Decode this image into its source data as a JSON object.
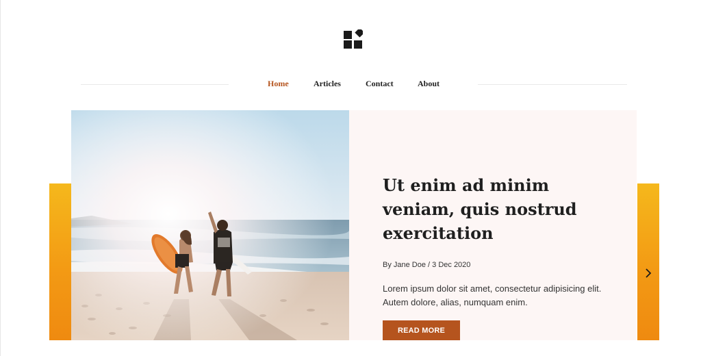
{
  "nav": {
    "items": [
      {
        "label": "Home",
        "active": true
      },
      {
        "label": "Articles",
        "active": false
      },
      {
        "label": "Contact",
        "active": false
      },
      {
        "label": "About",
        "active": false
      }
    ]
  },
  "logo": {
    "icon": "blocks-logo-icon"
  },
  "slide": {
    "title": "Ut enim ad minim veniam, quis nostrud exercitation",
    "author": "Jane Doe",
    "meta": "By Jane Doe / 3 Dec 2020",
    "excerpt": "Lorem ipsum dolor sit amet, consectetur adipisicing elit. Autem dolore, alias, numquam enim.",
    "cta": "READ MORE",
    "image_alt": "Two surfers walking on the beach toward the ocean"
  },
  "slider": {
    "next_icon": "chevron-right-icon"
  },
  "colors": {
    "accent": "#b5541e",
    "slider_gradient_top": "#f5b81c",
    "slider_gradient_bottom": "#ef8a10",
    "card_background": "#fdf6f5"
  }
}
